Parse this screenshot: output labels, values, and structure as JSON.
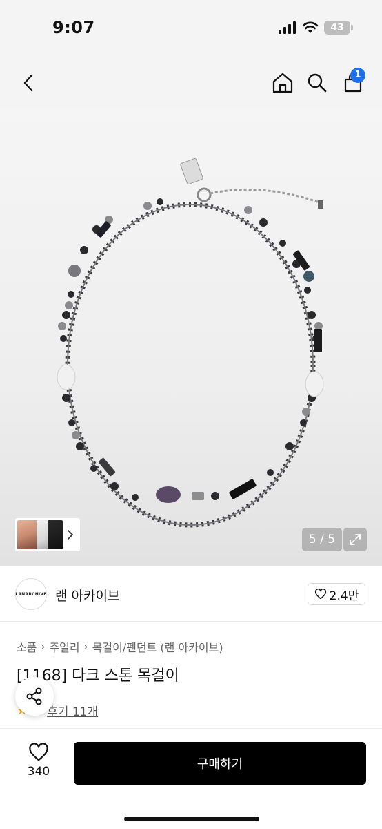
{
  "status_bar": {
    "time": "9:07",
    "battery": "43"
  },
  "nav": {
    "cart_count": "1"
  },
  "gallery": {
    "counter": "5 / 5"
  },
  "brand": {
    "logo_text": "LANARCHIVE",
    "name": "랜 아카이브",
    "likes": "2.4만"
  },
  "breadcrumb": [
    "소품",
    "주얼리",
    "목걸이/펜던트 (랜 아카이브)"
  ],
  "product": {
    "title": "[1168] 다크 스톤 목걸이",
    "reviews": "후기 11개"
  },
  "bottom": {
    "wish_count": "340",
    "buy_label": "구매하기"
  },
  "colors": {
    "accent": "#1f6feb",
    "buy_button": "#000000",
    "star": "#f4a300"
  }
}
